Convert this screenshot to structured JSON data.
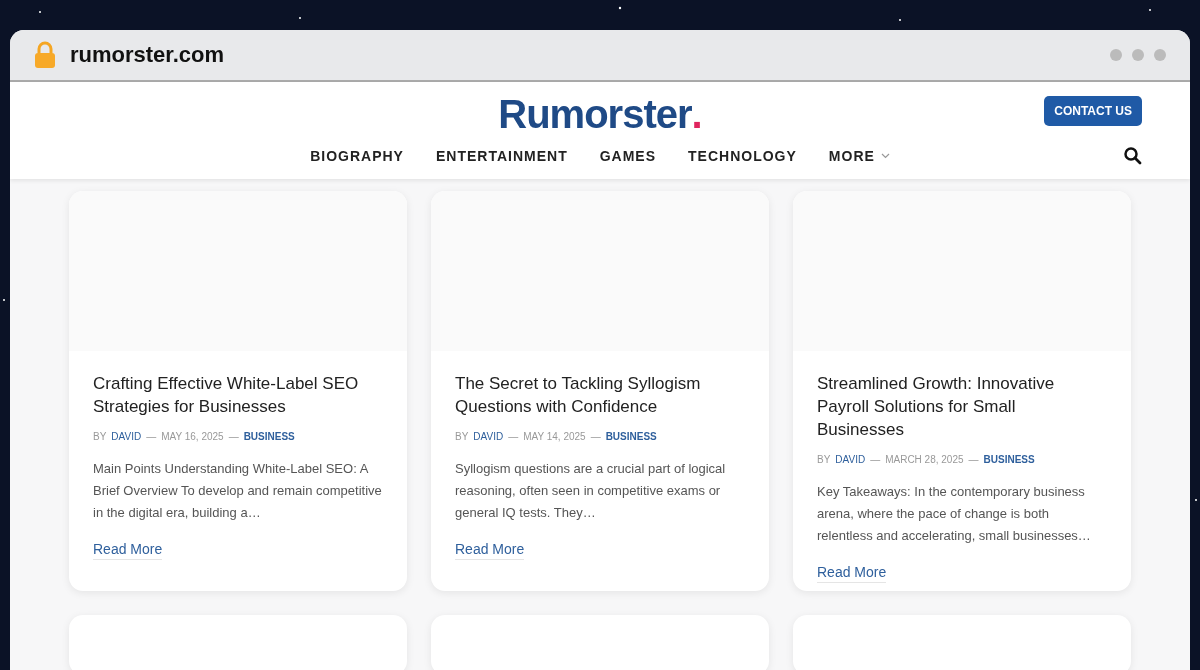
{
  "browser": {
    "address": "rumorster.com"
  },
  "header": {
    "logo": "Rumorster",
    "logo_mark": ".",
    "contact_button": "CONTACT US",
    "nav": [
      {
        "label": "BIOGRAPHY",
        "has_menu": false
      },
      {
        "label": "ENTERTAINMENT",
        "has_menu": false
      },
      {
        "label": "GAMES",
        "has_menu": false
      },
      {
        "label": "TECHNOLOGY",
        "has_menu": false
      },
      {
        "label": "MORE",
        "has_menu": true
      }
    ]
  },
  "posts": [
    {
      "title": "Crafting Effective White-Label SEO Strategies for Businesses",
      "by": "BY",
      "author": "DAVID",
      "date": "MAY 16, 2025",
      "category": "BUSINESS",
      "excerpt": "Main Points Understanding White-Label SEO: A Brief Overview To develop and remain competitive in the digital era, building a…",
      "link": "Read More"
    },
    {
      "title": "The Secret to Tackling Syllogism Questions with Confidence",
      "by": "BY",
      "author": "DAVID",
      "date": "MAY 14, 2025",
      "category": "BUSINESS",
      "excerpt": "Syllogism questions are a crucial part of logical reasoning, often seen in competitive exams or general IQ tests. They…",
      "link": "Read More"
    },
    {
      "title": "Streamlined Growth: Innovative Payroll Solutions for Small Businesses",
      "by": "BY",
      "author": "DAVID",
      "date": "MARCH 28, 2025",
      "category": "BUSINESS",
      "excerpt": "Key Takeaways: In the contemporary business arena, where the pace of change is both relentless and accelerating, small businesses…",
      "link": "Read More"
    }
  ],
  "separator": "—"
}
